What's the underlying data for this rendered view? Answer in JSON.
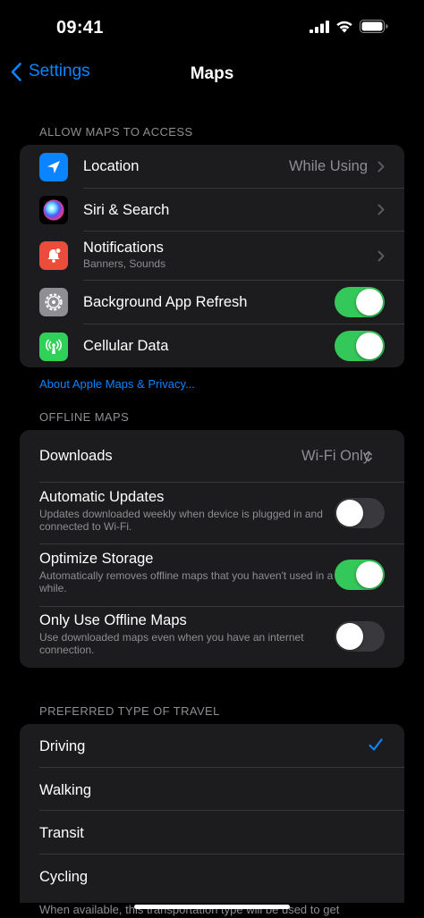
{
  "status_bar": {
    "time": "09:41"
  },
  "nav": {
    "back_label": "Settings",
    "title": "Maps"
  },
  "access": {
    "header": "ALLOW MAPS TO ACCESS",
    "rows": [
      {
        "label": "Location",
        "value": "While Using"
      },
      {
        "label": "Siri & Search"
      },
      {
        "label": "Notifications",
        "subtitle": "Banners, Sounds"
      },
      {
        "label": "Background App Refresh",
        "toggle": true
      },
      {
        "label": "Cellular Data",
        "toggle": true
      }
    ],
    "privacy_link": "About Apple Maps & Privacy..."
  },
  "offline": {
    "header": "OFFLINE MAPS",
    "downloads": {
      "label": "Downloads",
      "value": "Wi-Fi Only"
    },
    "rows": [
      {
        "label": "Automatic Updates",
        "subtitle": "Updates downloaded weekly when device is plugged in and connected to Wi-Fi.",
        "toggle": false
      },
      {
        "label": "Optimize Storage",
        "subtitle": "Automatically removes offline maps that you haven't used in a while.",
        "toggle": true
      },
      {
        "label": "Only Use Offline Maps",
        "subtitle": "Use downloaded maps even when you have an internet connection.",
        "toggle": false
      }
    ]
  },
  "travel": {
    "header": "PREFERRED TYPE OF TRAVEL",
    "options": [
      "Driving",
      "Walking",
      "Transit",
      "Cycling"
    ],
    "selected": "Driving",
    "footer": "When available, this transportation type will be used to get"
  },
  "colors": {
    "accent": "#0a84ff",
    "toggle_on": "#34c759",
    "toggle_off": "#39393d",
    "cell_bg": "#1c1c1e",
    "location_icon_bg": "#0a84ff",
    "notifications_icon_bg": "#eb4d3d",
    "refresh_icon_bg": "#8e8e93",
    "cellular_icon_bg": "#30d158"
  },
  "icons": [
    "signal-icon",
    "wifi-icon",
    "battery-icon",
    "chevron-left-icon",
    "location-arrow-icon",
    "siri-icon",
    "notification-bell-icon",
    "gear-icon",
    "antenna-icon",
    "chevron-right-icon",
    "up-down-chevron-icon",
    "checkmark-icon"
  ]
}
